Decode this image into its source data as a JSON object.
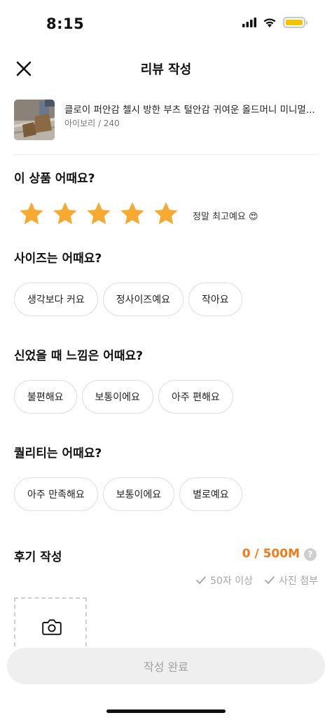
{
  "status_bar": {
    "time": "8:15",
    "battery_color": "#f5c400"
  },
  "nav": {
    "title": "리뷰 작성",
    "close_icon": "close-icon"
  },
  "product": {
    "name": "클로이 퍼안감 첼시 방한 부츠 털안감 귀여운 올드머니 미니멀...",
    "option": "아이보리 / 240"
  },
  "rating": {
    "question": "이 상품 어때요?",
    "stars_filled": 5,
    "stars_total": 5,
    "star_color": "#f7a931",
    "label": "정말 최고예요",
    "emoji": "😍"
  },
  "size": {
    "question": "사이즈는 어때요?",
    "options": [
      "생각보다 커요",
      "정사이즈예요",
      "작아요"
    ]
  },
  "comfort": {
    "question": "신었을 때 느낌은 어때요?",
    "options": [
      "불편해요",
      "보통이에요",
      "아주 편해요"
    ]
  },
  "quality": {
    "question": "퀄리티는 어때요?",
    "options": [
      "아주 만족해요",
      "보통이에요",
      "별로예요"
    ]
  },
  "review": {
    "title": "후기 작성",
    "count": "0 / 500M",
    "count_color": "#f27a1a",
    "help": "?",
    "requirements": [
      "50자 이상",
      "사진 첨부"
    ]
  },
  "submit": {
    "label": "작성 완료"
  }
}
